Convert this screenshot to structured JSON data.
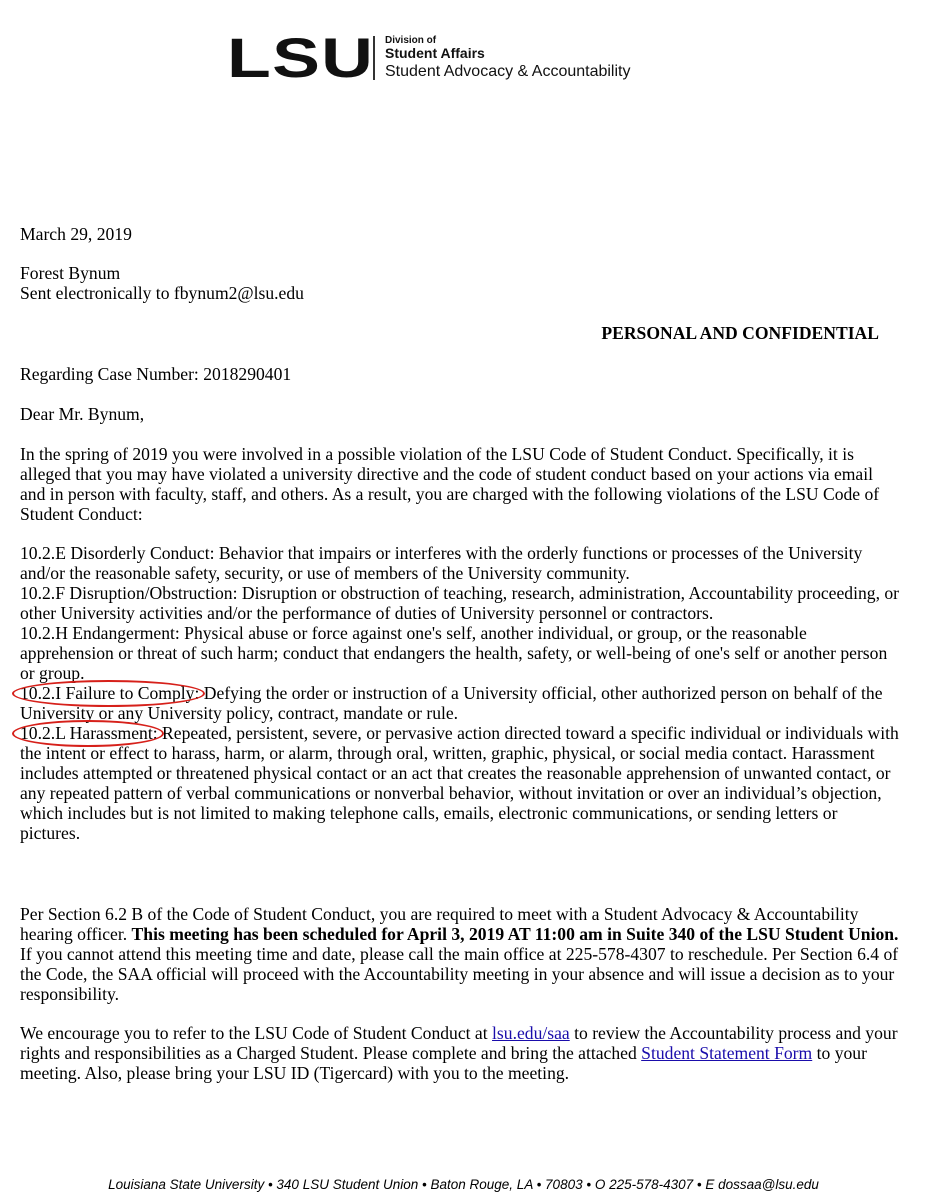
{
  "letterhead": {
    "logo": "LSU",
    "division": "Division of",
    "affairs": "Student Affairs",
    "department": "Student Advocacy & Accountability"
  },
  "date": "March 29, 2019",
  "recipient": {
    "name": "Forest Bynum",
    "sent": "Sent electronically to fbynum2@lsu.edu"
  },
  "confidential": "PERSONAL AND CONFIDENTIAL",
  "case_line": "Regarding Case Number: 2018290401",
  "salutation": "Dear Mr. Bynum,",
  "intro": "In the spring of 2019 you were involved in a possible violation of the LSU Code of Student Conduct. Specifically, it is alleged that you may have violated a university directive and the code of student conduct based on your actions via email and in person with faculty, staff, and others. As a result, you are charged with the following violations of the LSU Code of Student Conduct:",
  "violations": [
    {
      "code": "10.2.E Disorderly Conduct:",
      "text": " Behavior that impairs or interferes with the orderly functions or processes of the University and/or the reasonable safety, security, or use of members of the University community."
    },
    {
      "code": "10.2.F Disruption/Obstruction:",
      "text": " Disruption or obstruction of teaching, research, administration, Accountability proceeding, or other University activities and/or the performance of duties of University personnel or contractors."
    },
    {
      "code": "10.2.H Endangerment:",
      "text": " Physical abuse or force against one's self, another individual, or group, or the reasonable apprehension or threat of such harm; conduct that endangers the health, safety, or well-being of one's self or another person or group."
    },
    {
      "code": "10.2.I Failure to Comply:",
      "text": " Defying the order or instruction of a University official, other authorized person on behalf of the University or any University policy, contract, mandate or rule."
    },
    {
      "code": "10.2.L Harassment:",
      "text": " Repeated, persistent, severe, or pervasive action directed toward a specific individual or individuals with the intent or effect to harass, harm, or alarm, through oral, written, graphic, physical, or social media contact. Harassment includes attempted or threatened physical contact or an act that creates the reasonable apprehension of unwanted contact, or any repeated pattern of verbal communications or nonverbal behavior, without invitation or over an individual’s objection, which includes but is not limited to making telephone calls, emails, electronic communications, or sending letters or pictures."
    }
  ],
  "meeting": {
    "part1": "Per Section 6.2 B of the Code of Student Conduct, you are required to meet with a Student Advocacy & Accountability hearing officer. ",
    "bold": "This meeting has been scheduled for April 3, 2019 AT 11:00 am in Suite 340 of the LSU Student Union.",
    "part2": " If you cannot attend this meeting time and date, please call the main office at 225-578-4307 to reschedule. Per Section 6.4 of the Code, the SAA official will proceed with the Accountability meeting in your absence and will issue a decision as to your responsibility."
  },
  "encourage": {
    "part1": "We encourage you to refer to the LSU Code of Student Conduct at ",
    "link1": "lsu.edu/saa",
    "part2": " to review the Accountability process and your rights and responsibilities as a Charged Student. Please complete and bring the attached ",
    "link2": "Student Statement Form",
    "part3": " to your meeting. Also, please bring your LSU ID (Tigercard) with you to the meeting."
  },
  "footer": "Louisiana State University • 340 LSU Student Union • Baton Rouge, LA • 70803 • O 225-578-4307 • E dossaa@lsu.edu",
  "annotation_color": "#d6201a"
}
